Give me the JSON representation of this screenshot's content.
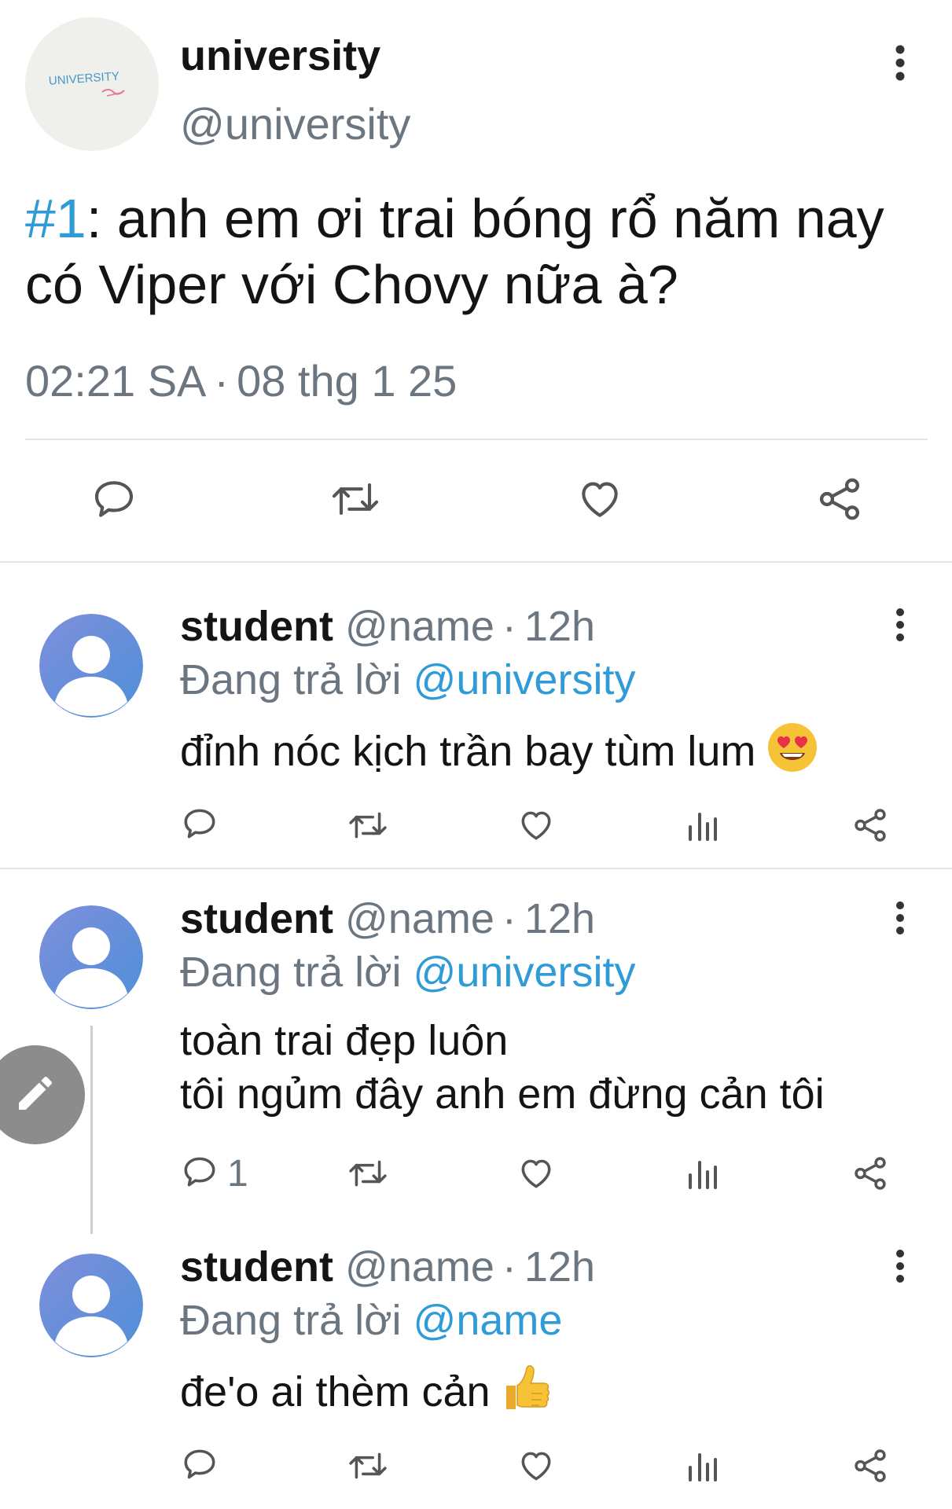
{
  "main_tweet": {
    "author_name": "university",
    "author_handle": "@university",
    "avatar_text": "UNIVERSITY",
    "hashtag": "#1",
    "text": ": anh em ơi trai bóng rổ năm nay có Viper với Chovy nữa à?",
    "time": "02:21 SA",
    "separator": "·",
    "date": "08 thg 1 25",
    "actions": [
      "reply-icon",
      "retweet-icon",
      "like-icon",
      "share-icon"
    ]
  },
  "replies": [
    {
      "name": "student",
      "handle": "@name",
      "separator": "·",
      "age": "12h",
      "replying_label": "Đang trả lời",
      "replying_to": "@university",
      "lines": [
        "đỉnh nóc kịch trần bay tùm lum"
      ],
      "emoji": "smiling-face-heart-eyes",
      "reply_count": ""
    },
    {
      "name": "student",
      "handle": "@name",
      "separator": "·",
      "age": "12h",
      "replying_label": "Đang trả lời",
      "replying_to": "@university",
      "lines": [
        "toàn trai đẹp luôn",
        "tôi ngủm đây anh em đừng cản tôi"
      ],
      "emoji": "",
      "reply_count": "1"
    },
    {
      "name": "student",
      "handle": "@name",
      "separator": "·",
      "age": "12h",
      "replying_label": "Đang trả lời",
      "replying_to": "@name",
      "lines": [
        "đe'o ai thèm cản"
      ],
      "emoji": "thumbs-up",
      "reply_count": ""
    }
  ],
  "colors": {
    "link": "#2f9bd7",
    "muted": "#6b7680",
    "text": "#141414",
    "avatar_default": "#6d86d6",
    "emoji_yellow": "#f7c336",
    "heart": "#e8304a",
    "fab": "#8c8c8c"
  },
  "fab": {
    "icon": "pencil-icon"
  }
}
